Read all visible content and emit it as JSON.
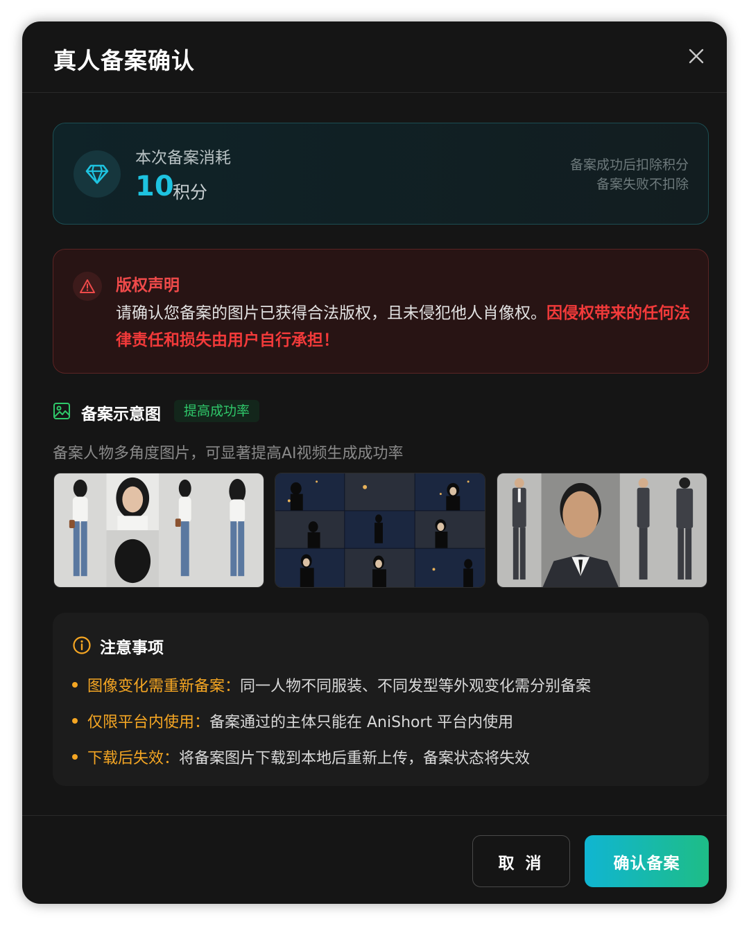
{
  "dialog": {
    "title": "真人备案确认"
  },
  "cost": {
    "label": "本次备案消耗",
    "value": "10",
    "unit": "积分",
    "note_line1": "备案成功后扣除积分",
    "note_line2": "备案失败不扣除",
    "icon": "diamond-icon",
    "accent_color": "#1ec3e0"
  },
  "copyright": {
    "title": "版权声明",
    "body_normal": "请确认您备案的图片已获得合法版权，且未侵犯他人肖像权。",
    "body_highlight": "因侵权带来的任何法律责任和损失由用户自行承担！",
    "icon": "warning-triangle-icon",
    "color": "#ef4a4a"
  },
  "example": {
    "title": "备案示意图",
    "badge": "提高成功率",
    "description": "备案人物多角度图片，可显著提高AI视频生成成功率",
    "icon": "image-icon",
    "thumbnails": [
      "woman-multi-angle-reference",
      "night-city-scene-frames",
      "man-in-suit-multi-angle-reference"
    ]
  },
  "notes": {
    "title": "注意事项",
    "icon": "info-icon",
    "items": [
      {
        "key": "图像变化需重新备案：",
        "text": "同一人物不同服装、不同发型等外观变化需分别备案"
      },
      {
        "key": "仅限平台内使用：",
        "text": "备案通过的主体只能在 AniShort 平台内使用"
      },
      {
        "key": "下载后失效：",
        "text": "将备案图片下载到本地后重新上传，备案状态将失效"
      }
    ],
    "accent_color": "#f5a623"
  },
  "footer": {
    "cancel_label": "取 消",
    "confirm_label": "确认备案"
  }
}
